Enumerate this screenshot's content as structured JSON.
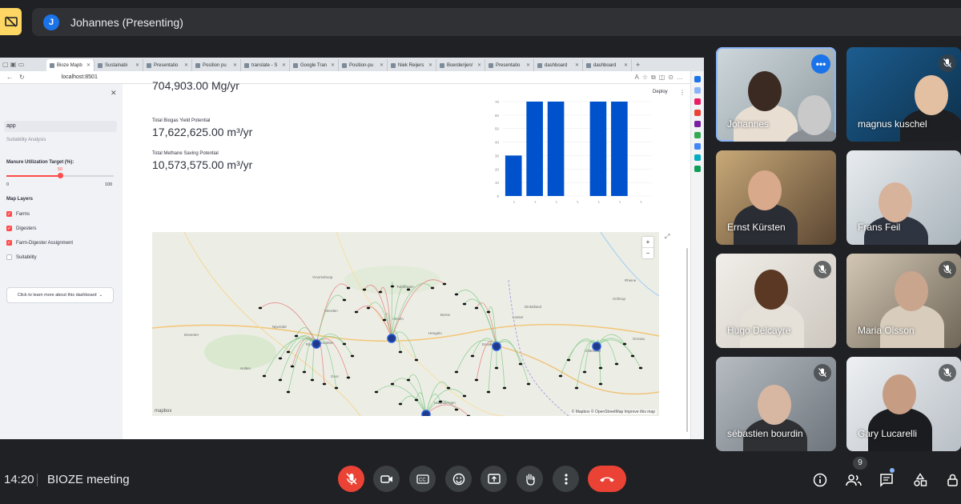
{
  "meet": {
    "presenter_initial": "J",
    "presenter_label": "Johannes (Presenting)",
    "time": "14:20",
    "meeting_name": "BIOZE meeting",
    "participant_count": "9"
  },
  "browser": {
    "tabs": [
      "Bioze Mapb",
      "Sustainabi",
      "Presentatio",
      "Position pu",
      "translate - S",
      "Google Tran",
      "Position-pu",
      "Niek Reijers",
      "Boerderijen/",
      "Presentatio",
      "dashboard",
      "dashboard"
    ],
    "url": "localhost:8501"
  },
  "app": {
    "page_item": "app",
    "page_sub": "Suitability Analysis",
    "slider_label": "Manure Utilization Target (%):",
    "slider_value": "50",
    "slider_min": "0",
    "slider_max": "100",
    "layers_title": "Map Layers",
    "layers": [
      {
        "label": "Farms",
        "checked": true
      },
      {
        "label": "Digesters",
        "checked": true
      },
      {
        "label": "Farm-Digester Assignment",
        "checked": true
      },
      {
        "label": "Suitability",
        "checked": false
      }
    ],
    "learn_more": "Click to learn more about this dashboard",
    "deploy": "Deploy",
    "top_partial_value": "704,903.00 Mg/yr",
    "metric1_label": "Total Biogas Yield Potential",
    "metric1_value": "17,622,625.00 m³/yr",
    "metric2_label": "Total Methane Saving Potential",
    "metric2_value": "10,573,575.00 m³/yr",
    "map_credit": "© Mapbox © OpenStreetMap  Improve this map",
    "mapbox_logo": "mapbox",
    "map_places": [
      "Zutphen",
      "Hengelo",
      "Enschede",
      "Haaksbergen",
      "Almelo",
      "Nijverdal",
      "Rijssen",
      "Holten",
      "Goor",
      "Oldenzaal",
      "Losser",
      "Borne",
      "Wierden",
      "Deventer",
      "Nationaal Park De Sallandse Heuvelrug",
      "Vroomshoop",
      "Tubbergen",
      "Rheine",
      "Ochtrup",
      "Dinkelland",
      "Gronau"
    ]
  },
  "chart_data": {
    "type": "bar",
    "categories": [
      "",
      "",
      "",
      "",
      "",
      "",
      ""
    ],
    "values": [
      30,
      70,
      70,
      0,
      70,
      70,
      0
    ],
    "yticks": [
      "70",
      "60",
      "50",
      "40",
      "30",
      "20",
      "10",
      "0"
    ],
    "ylim": [
      0,
      70
    ],
    "color": "#0052cc"
  },
  "participants": [
    {
      "name": "Johannes",
      "muted": false
    },
    {
      "name": "magnus kuschel",
      "muted": true
    },
    {
      "name": "Ernst Kürsten",
      "muted": false
    },
    {
      "name": "Frans Feil",
      "muted": false
    },
    {
      "name": "Hugo Delcayre",
      "muted": true
    },
    {
      "name": "Maria Olsson",
      "muted": true
    },
    {
      "name": "sébastien bourdin",
      "muted": true
    },
    {
      "name": "Gary Lucarelli",
      "muted": true
    }
  ],
  "colors": {
    "accent": "#ff4b4b",
    "meet_red": "#ea4335",
    "meet_blue": "#8ab4f8",
    "bar": "#0052cc"
  }
}
